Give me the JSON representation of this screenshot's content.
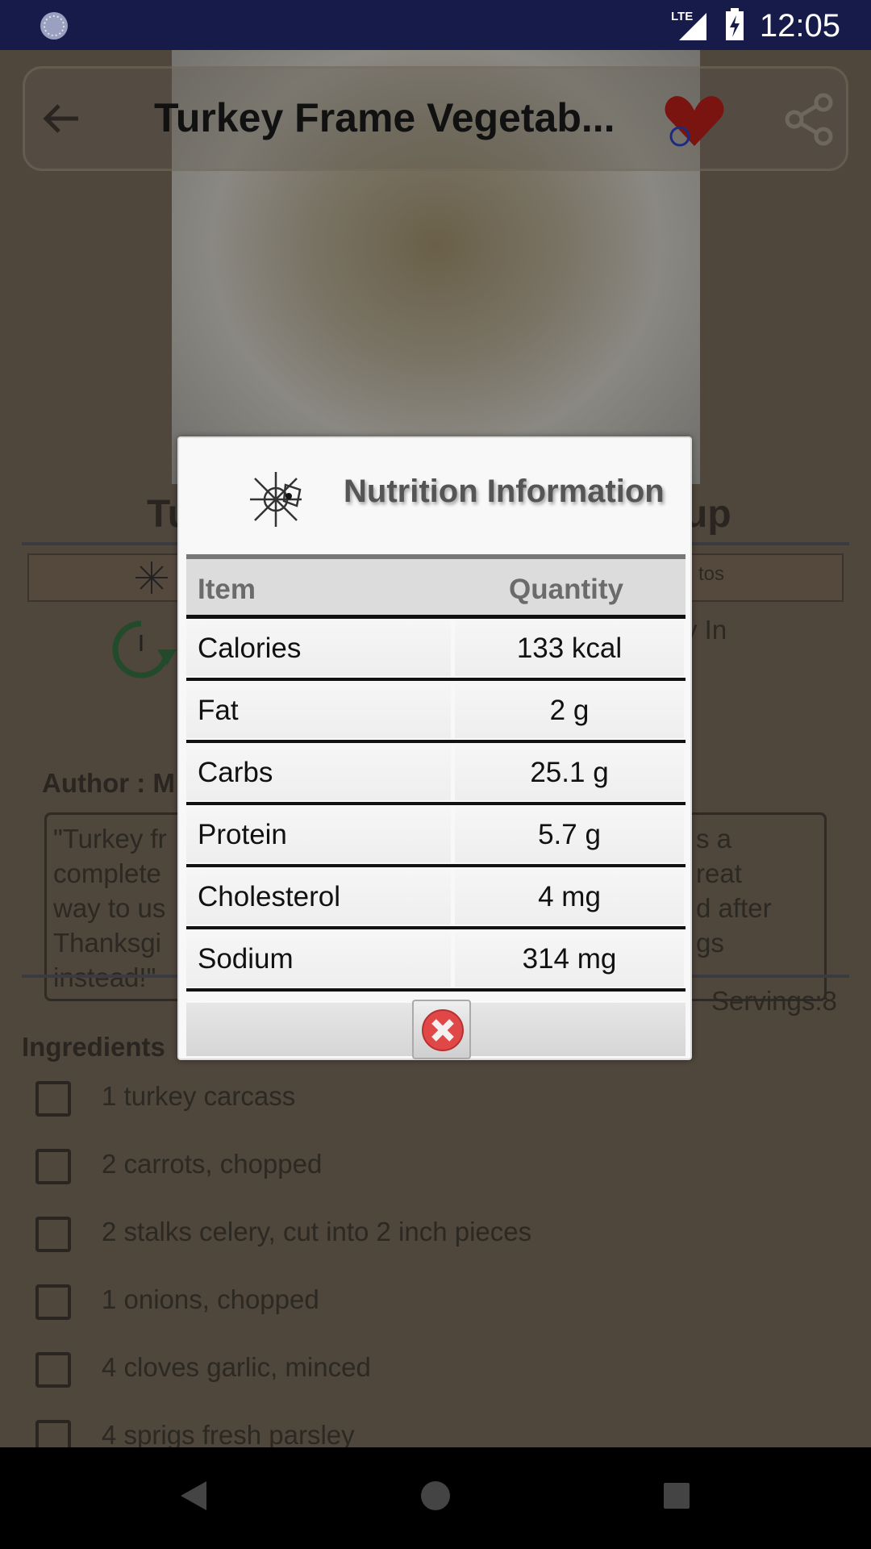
{
  "status_bar": {
    "time": "12:05",
    "network": "LTE"
  },
  "toolbar": {
    "title": "Turkey Frame Vegetab...",
    "icons": [
      "back-arrow-icon",
      "favorite-heart-icon",
      "share-icon"
    ]
  },
  "background": {
    "recipe_title_left": "Tu",
    "recipe_title_right": "up",
    "tab_fragment": "tos",
    "time_fragment": "y In",
    "author_fragment": "Author : M",
    "description_left": [
      "\"Turkey fr",
      "complete",
      "way to us",
      "Thanksgi",
      "instead!\""
    ],
    "description_right": [
      "s a",
      "reat",
      "d after",
      "gs",
      ""
    ],
    "servings": "Servings:8",
    "ingredients_label": "Ingredients",
    "ingredients": [
      "1 turkey carcass",
      "2 carrots, chopped",
      "2 stalks celery, cut into 2 inch pieces",
      "1 onions, chopped",
      "4 cloves garlic, minced",
      "4 sprigs fresh parsley"
    ]
  },
  "dialog": {
    "title": "Nutrition Information",
    "headers": {
      "item": "Item",
      "quantity": "Quantity"
    },
    "rows": [
      {
        "item": "Calories",
        "quantity": "133 kcal"
      },
      {
        "item": "Fat",
        "quantity": "2 g"
      },
      {
        "item": "Carbs",
        "quantity": "25.1 g"
      },
      {
        "item": "Protein",
        "quantity": "5.7 g"
      },
      {
        "item": "Cholesterol",
        "quantity": "4 mg"
      },
      {
        "item": "Sodium",
        "quantity": "314 mg"
      }
    ],
    "close_icon": "close-x-icon"
  },
  "colors": {
    "status_bar": "#161b4a",
    "close_red": "#e04848",
    "timer_green": "#2e5a36"
  }
}
